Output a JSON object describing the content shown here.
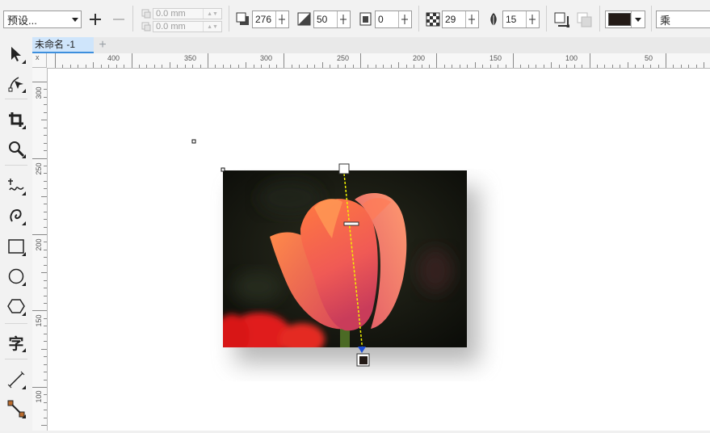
{
  "propbar": {
    "preset_label": "预设...",
    "offset_x": "0.0 mm",
    "offset_y": "0.0 mm",
    "direction_value": "276",
    "distance_value": "50",
    "fade_value": "0",
    "opacity_value": "29",
    "feather_value": "15",
    "color_hex": "#231a16",
    "merge_mode_label": "乘"
  },
  "document": {
    "tab_name": "未命名 -1",
    "add_tab_symbol": "+"
  },
  "rulers": {
    "horizontal": [
      "400",
      "350",
      "300",
      "250",
      "200",
      "150",
      "100",
      "50"
    ],
    "vertical": [
      "300",
      "250",
      "200",
      "150",
      "100"
    ],
    "corner_label": "x"
  },
  "toolbox": {
    "tool_text_symbol": "字"
  },
  "colors": {
    "accent": "#3d8fdd",
    "shadow_handle_fill": "#231a16",
    "guide_line": "#e8e800"
  }
}
